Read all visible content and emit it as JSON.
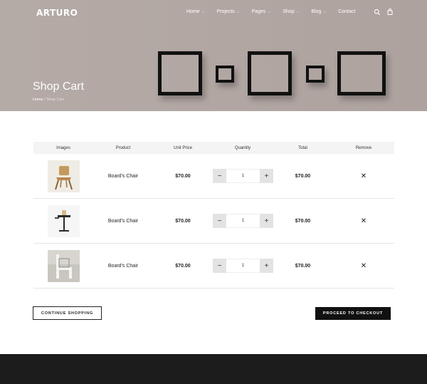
{
  "header": {
    "logo_text": "ARTURO",
    "nav": [
      {
        "label": "Home",
        "has_dropdown": true
      },
      {
        "label": "Projects",
        "has_dropdown": true
      },
      {
        "label": "Pages",
        "has_dropdown": true
      },
      {
        "label": "Shop",
        "has_dropdown": true
      },
      {
        "label": "Blog",
        "has_dropdown": true
      },
      {
        "label": "Contact",
        "has_dropdown": false
      }
    ],
    "icons": [
      "search-icon",
      "cart-icon"
    ]
  },
  "hero": {
    "title": "Shop Cart",
    "breadcrumb": {
      "home": "Home",
      "separator": "/",
      "current": "Shop Cart"
    }
  },
  "cart": {
    "columns": [
      "Images",
      "Product",
      "Unit Price",
      "Quantity",
      "Total",
      "Remove"
    ],
    "rows": [
      {
        "image": "wooden-chair",
        "product": "Board's Chair",
        "unit_price": "$70.00",
        "quantity": "1",
        "total": "$70.00"
      },
      {
        "image": "table-lamp",
        "product": "Board's Chair",
        "unit_price": "$70.00",
        "quantity": "1",
        "total": "$70.00"
      },
      {
        "image": "white-chair",
        "product": "Board's Chair",
        "unit_price": "$70.00",
        "quantity": "1",
        "total": "$70.00"
      }
    ],
    "minus_label": "−",
    "plus_label": "+",
    "remove_label": "✕"
  },
  "actions": {
    "continue_label": "CONTINUE SHOPPING",
    "checkout_label": "PROCEED TO CHECKOUT"
  },
  "colors": {
    "hero_bg": "#b2a7a3",
    "checkout_bg": "#111111",
    "footer_bg": "#1c1c1c",
    "qty_button_bg": "#e3e3e3"
  }
}
